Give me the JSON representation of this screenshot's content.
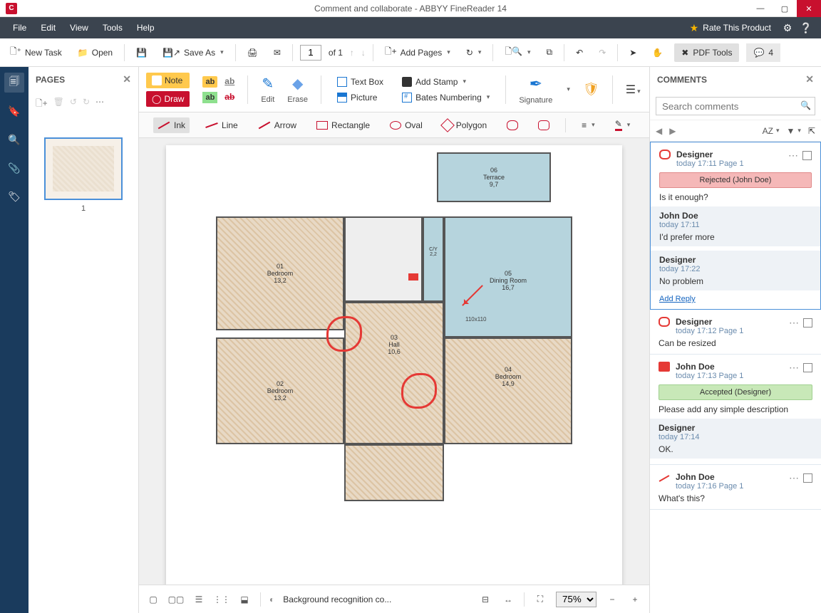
{
  "window": {
    "title": "Comment and collaborate - ABBYY FineReader 14"
  },
  "menu": {
    "file": "File",
    "edit": "Edit",
    "view": "View",
    "tools": "Tools",
    "help": "Help",
    "rate": "Rate This Product"
  },
  "toolbar": {
    "new_task": "New Task",
    "open": "Open",
    "save_as": "Save As",
    "page_current": "1",
    "page_of": "of 1",
    "add_pages": "Add Pages",
    "pdf_tools": "PDF Tools",
    "chat_count": "4"
  },
  "pages_panel": {
    "title": "PAGES",
    "thumb_label": "1"
  },
  "ribbon": {
    "note": "Note",
    "draw": "Draw",
    "highlight_ab": "ab",
    "edit": "Edit",
    "erase": "Erase",
    "textbox": "Text Box",
    "picture": "Picture",
    "add_stamp": "Add Stamp",
    "bates": "Bates Numbering",
    "signature": "Signature"
  },
  "drawbar": {
    "ink": "Ink",
    "line": "Line",
    "arrow": "Arrow",
    "rectangle": "Rectangle",
    "oval": "Oval",
    "polygon": "Polygon"
  },
  "floorplan": {
    "terrace": "06\nTerrace\n9,7",
    "dining": "05\nDining Room\n16,7",
    "bedroom1": "01\nBedroom\n13,2",
    "bedroom2": "02\nBedroom\n13,2",
    "bedroom4": "04\nBedroom\n14,9",
    "hall": "03\nHall\n10,6",
    "cy": "C/Y\n2,2",
    "dim_110x110": "110x110"
  },
  "bottombar": {
    "bg_recog": "Background recognition co...",
    "zoom": "75%"
  },
  "comments_panel": {
    "title": "COMMENTS",
    "search_placeholder": "Search comments",
    "sort": "AZ",
    "threads": [
      {
        "icon": "cloud",
        "author": "Designer",
        "meta": "today 17:11   Page 1",
        "status": "Rejected (John Doe)",
        "status_kind": "rejected",
        "text": "Is it enough?",
        "replies": [
          {
            "author": "John Doe",
            "meta": "today 17:11",
            "text": "I'd prefer more"
          },
          {
            "author": "Designer",
            "meta": "today 17:22",
            "text": "No problem"
          }
        ],
        "add_reply": "Add Reply",
        "active": true
      },
      {
        "icon": "cloud",
        "author": "Designer",
        "meta": "today 17:12   Page 1",
        "text": "Can be resized"
      },
      {
        "icon": "note",
        "author": "John Doe",
        "meta": "today 17:13   Page 1",
        "status": "Accepted (Designer)",
        "status_kind": "accepted",
        "text": "Please add any simple description",
        "replies": [
          {
            "author": "Designer",
            "meta": "today 17:14",
            "text": "OK."
          }
        ]
      },
      {
        "icon": "arrow",
        "author": "John Doe",
        "meta": "today 17:16   Page 1",
        "text": "What's this?"
      }
    ]
  }
}
